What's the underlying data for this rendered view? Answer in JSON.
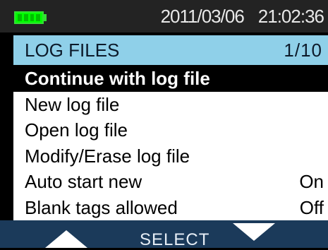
{
  "status": {
    "date": "2011/03/06",
    "time": "21:02:36",
    "battery_icon": "battery-full-icon",
    "battery_color": "#00ff00"
  },
  "header": {
    "title": "LOG FILES",
    "page": "1/10",
    "bg_color": "#8fd0e9"
  },
  "menu": {
    "items": [
      {
        "label": "Continue with log file",
        "value": ""
      },
      {
        "label": "New log file",
        "value": ""
      },
      {
        "label": "Open log file",
        "value": ""
      },
      {
        "label": "Modify/Erase log file",
        "value": ""
      },
      {
        "label": "Auto start new",
        "value": "On"
      },
      {
        "label": "Blank tags allowed",
        "value": "Off"
      }
    ]
  },
  "softkeys": {
    "left_icon": "arrow-up-icon",
    "center_label": "SELECT",
    "right_icon": "arrow-down-icon"
  }
}
